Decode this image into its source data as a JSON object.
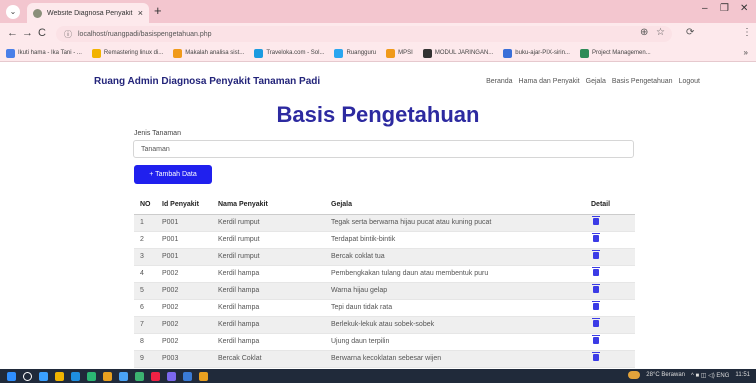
{
  "browser": {
    "tab_title": "Website Diagnosa Penyakit Tan",
    "tab_close": "×",
    "new_tab": "+",
    "tab_menu": "⌄",
    "controls": {
      "minimize": "–",
      "restore": "❐",
      "close": "✕"
    },
    "nav": {
      "back": "←",
      "forward": "→",
      "reload": "C"
    },
    "url": "localhost/ruangpadi/basispengetahuan.php",
    "url_info": "ⓘ",
    "url_actions": {
      "zoom": "⊕",
      "star": "☆",
      "extensions": "⟳",
      "menu": "⋮"
    },
    "bookmarks": [
      {
        "label": "Ikuti hama - Ika Tani - ...",
        "color": "#4a7fe8"
      },
      {
        "label": "Remastering linux di...",
        "color": "#f2b300"
      },
      {
        "label": "Makalah analisa sist...",
        "color": "#f09a1a"
      },
      {
        "label": "Traveloka.com - Sol...",
        "color": "#1b9be0"
      },
      {
        "label": "Ruangguru",
        "color": "#2aa6f0"
      },
      {
        "label": "MPSI",
        "color": "#f09a1a"
      },
      {
        "label": "MODUL JARINGAN...",
        "color": "#333333"
      },
      {
        "label": "buku-ajar-PIX-sirin...",
        "color": "#3a6fd8"
      },
      {
        "label": "Project Managemen...",
        "color": "#2e8b57"
      }
    ],
    "bookmarks_more": "»"
  },
  "site": {
    "brand": "Ruang Admin Diagnosa Penyakit Tanaman Padi",
    "nav": [
      "Beranda",
      "Hama dan Penyakit",
      "Gejala",
      "Basis Pengetahuan",
      "Logout"
    ],
    "heading": "Basis Pengetahuan",
    "jenis_label": "Jenis Tanaman",
    "jenis_value": "Tanaman",
    "add_button": "+ Tambah Data",
    "columns": [
      "NO",
      "Id Penyakit",
      "Nama Penyakit",
      "Gejala",
      "Detail"
    ],
    "rows": [
      {
        "no": "1",
        "id": "P001",
        "nama": "Kerdil rumput",
        "gejala": "Tegak serta berwarna hijau pucat atau kuning pucat"
      },
      {
        "no": "2",
        "id": "P001",
        "nama": "Kerdil rumput",
        "gejala": "Terdapat bintik-bintik"
      },
      {
        "no": "3",
        "id": "P001",
        "nama": "Kerdil rumput",
        "gejala": "Bercak coklat tua"
      },
      {
        "no": "4",
        "id": "P002",
        "nama": "Kerdil hampa",
        "gejala": "Pembengkakan tulang daun atau membentuk puru"
      },
      {
        "no": "5",
        "id": "P002",
        "nama": "Kerdil hampa",
        "gejala": "Warna hijau gelap"
      },
      {
        "no": "6",
        "id": "P002",
        "nama": "Kerdil hampa",
        "gejala": "Tepi daun tidak rata"
      },
      {
        "no": "7",
        "id": "P002",
        "nama": "Kerdil hampa",
        "gejala": "Berlekuk-lekuk atau sobek-sobek"
      },
      {
        "no": "8",
        "id": "P002",
        "nama": "Kerdil hampa",
        "gejala": "Ujung daun terpilin"
      },
      {
        "no": "9",
        "id": "P003",
        "nama": "Bercak Coklat",
        "gejala": "Berwarna kecoklatan sebesar wijen"
      }
    ]
  },
  "taskbar": {
    "icons": [
      "#2f8fff",
      "#ffffff",
      "#3aa0ff",
      "#f0b400",
      "#1e8fe0",
      "#2bb673",
      "#e8a020",
      "#4aa3f5",
      "#3cb371",
      "#e24",
      "#7b68ee",
      "#3a7bd5",
      "#e8a020"
    ],
    "weather": "28°C Berawan",
    "tray": "^ ■ ◫ ◁) ENG",
    "time": "11:51"
  }
}
